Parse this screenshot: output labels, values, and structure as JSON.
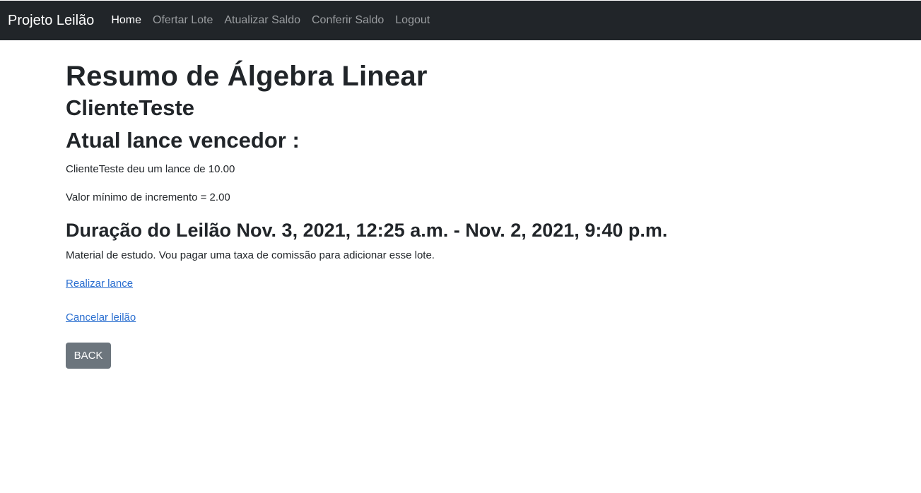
{
  "navbar": {
    "brand": "Projeto Leilão",
    "links": [
      {
        "label": "Home",
        "active": true
      },
      {
        "label": "Ofertar Lote",
        "active": false
      },
      {
        "label": "Atualizar Saldo",
        "active": false
      },
      {
        "label": "Conferir Saldo",
        "active": false
      },
      {
        "label": "Logout",
        "active": false
      }
    ]
  },
  "lot": {
    "title": "Resumo de Álgebra Linear",
    "owner": "ClienteTeste",
    "winning_bid_heading": "Atual lance vencedor :",
    "bid_text": "ClienteTeste deu um lance de 10.00",
    "min_increment_text": "Valor mínimo de incremento = 2.00",
    "duration_text": "Duração do Leilão Nov. 3, 2021, 12:25 a.m. - Nov. 2, 2021, 9:40 p.m.",
    "description": "Material de estudo. Vou pagar uma taxa de comissão para adicionar esse lote."
  },
  "actions": {
    "place_bid": "Realizar lance",
    "cancel_auction": "Cancelar leilão",
    "back": "BACK"
  },
  "colors": {
    "navbar_bg": "#212529",
    "link": "#2b6fd0",
    "button_bg": "#6c757d"
  }
}
